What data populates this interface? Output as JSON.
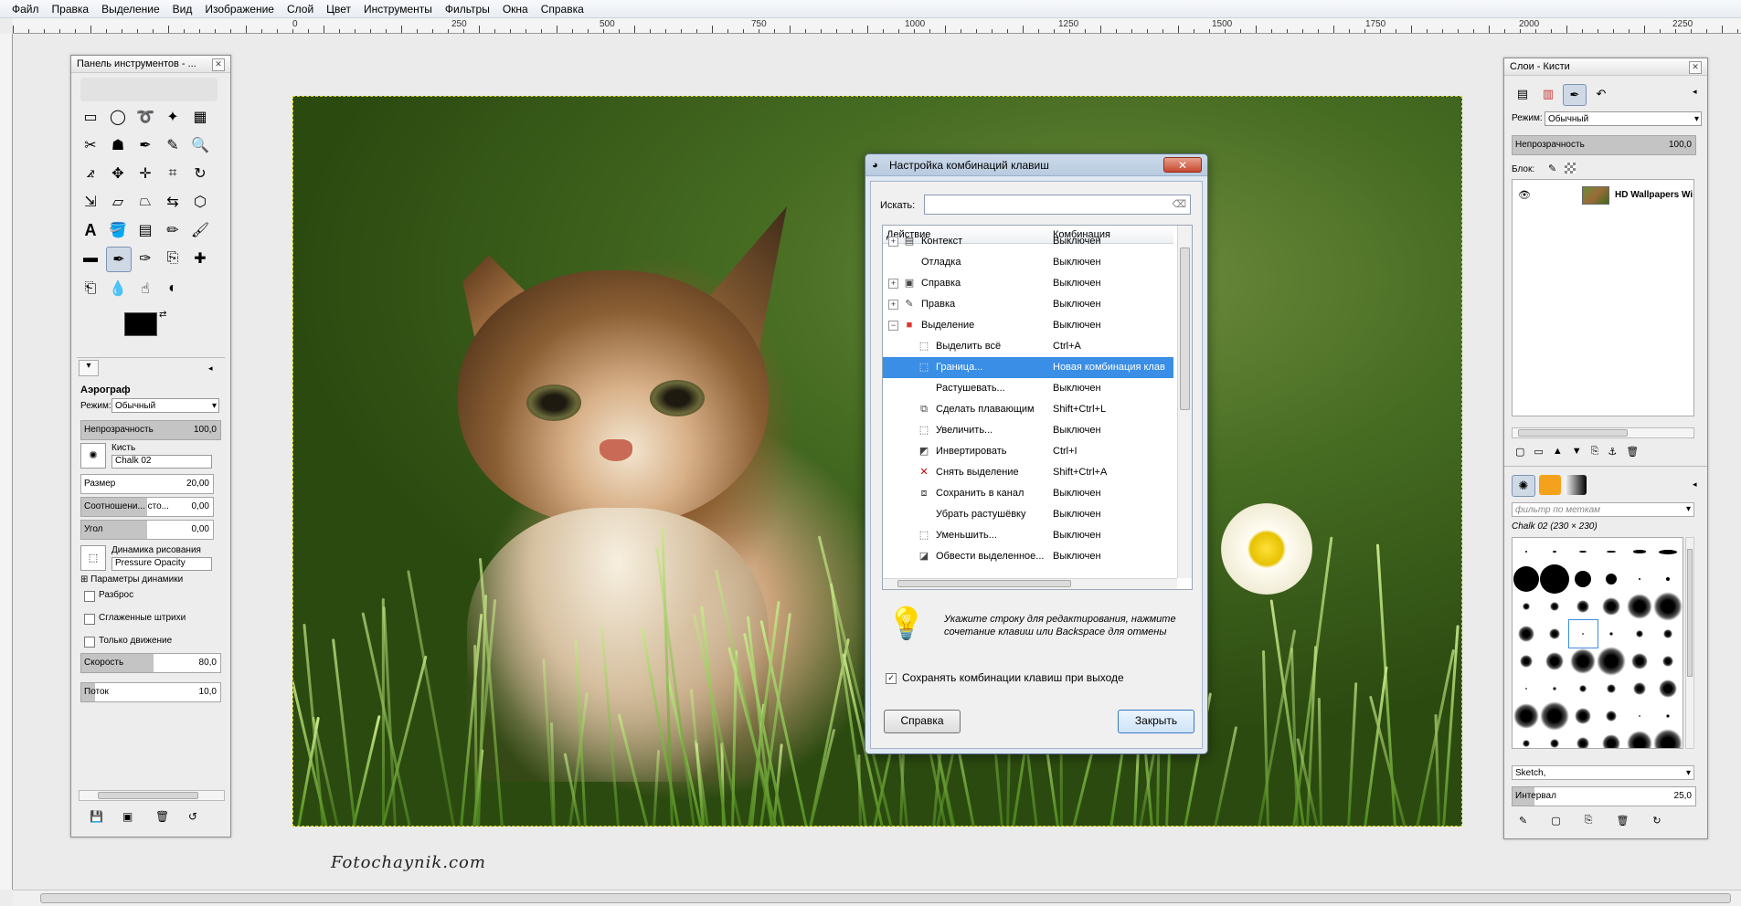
{
  "menubar": [
    "Файл",
    "Правка",
    "Выделение",
    "Вид",
    "Изображение",
    "Слой",
    "Цвет",
    "Инструменты",
    "Фильтры",
    "Окна",
    "Справка"
  ],
  "ruler": {
    "labels": [
      "250",
      "0",
      "250",
      "500",
      "750",
      "1000",
      "1250",
      "1500",
      "1750",
      "2000",
      "2250"
    ]
  },
  "toolbox": {
    "title": "Панель инструментов - ...",
    "tool_name": "Аэрограф",
    "mode_label": "Режим:",
    "mode_value": "Обычный",
    "opacity_label": "Непрозрачность",
    "opacity_value": "100,0",
    "brush_label": "Кисть",
    "brush_value": "Chalk 02",
    "size_label": "Размер",
    "size_value": "20,00",
    "ratio_label": "Соотношени... сто...",
    "ratio_value": "0,00",
    "angle_label": "Угол",
    "angle_value": "0,00",
    "dynamics_label": "Динамика рисования",
    "dynamics_value": "Pressure Opacity",
    "dynamics_params": "Параметры динамики",
    "scatter": "Разброс",
    "smooth": "Сглаженные штрихи",
    "motion_only": "Только движение",
    "speed_label": "Скорость",
    "speed_value": "80,0",
    "flow_label": "Поток",
    "flow_value": "10,0"
  },
  "image": {
    "watermark": "Fotochaynik.com"
  },
  "dialog": {
    "title": "Настройка комбинаций клавиш",
    "search_label": "Искать:",
    "col_action": "Действие",
    "col_shortcut": "Комбинация",
    "rows": [
      {
        "action": "Контекст",
        "shortcut": "Выключен"
      },
      {
        "action": "Отладка",
        "shortcut": "Выключен"
      },
      {
        "action": "Справка",
        "shortcut": "Выключен"
      },
      {
        "action": "Правка",
        "shortcut": "Выключен"
      },
      {
        "action": "Выделение",
        "shortcut": "Выключен"
      },
      {
        "action": "Выделить всё",
        "shortcut": "Ctrl+A"
      },
      {
        "action": "Граница...",
        "shortcut": "Новая комбинация клав"
      },
      {
        "action": "Растушевать...",
        "shortcut": "Выключен"
      },
      {
        "action": "Сделать плавающим",
        "shortcut": "Shift+Ctrl+L"
      },
      {
        "action": "Увеличить...",
        "shortcut": "Выключен"
      },
      {
        "action": "Инвертировать",
        "shortcut": "Ctrl+I"
      },
      {
        "action": "Снять выделение",
        "shortcut": "Shift+Ctrl+A"
      },
      {
        "action": "Сохранить в канал",
        "shortcut": "Выключен"
      },
      {
        "action": "Убрать растушёвку",
        "shortcut": "Выключен"
      },
      {
        "action": "Уменьшить...",
        "shortcut": "Выключен"
      },
      {
        "action": "Обвести выделенное...",
        "shortcut": "Выключен"
      }
    ],
    "hint": "Укажите строку для редактирования, нажмите сочетание клавиш или Backspace для отмены",
    "save_checkbox": "Сохранять комбинации клавиш при выходе",
    "help_button": "Справка",
    "close_button": "Закрыть"
  },
  "layers": {
    "title": "Слои - Кисти",
    "mode_label": "Режим:",
    "mode_value": "Обычный",
    "opacity_label": "Непрозрачность",
    "opacity_value": "100,0",
    "lock_label": "Блок:",
    "layer_name": "HD Wallpapers Wi",
    "filter_placeholder": "фильтр по меткам",
    "brush_info": "Chalk 02 (230 × 230)",
    "brush_tag": "Sketch,",
    "spacing_label": "Интервал",
    "spacing_value": "25,0"
  },
  "colors": {
    "accent": "#3a8ee6",
    "dialog_frame": "#dfe8f3"
  }
}
